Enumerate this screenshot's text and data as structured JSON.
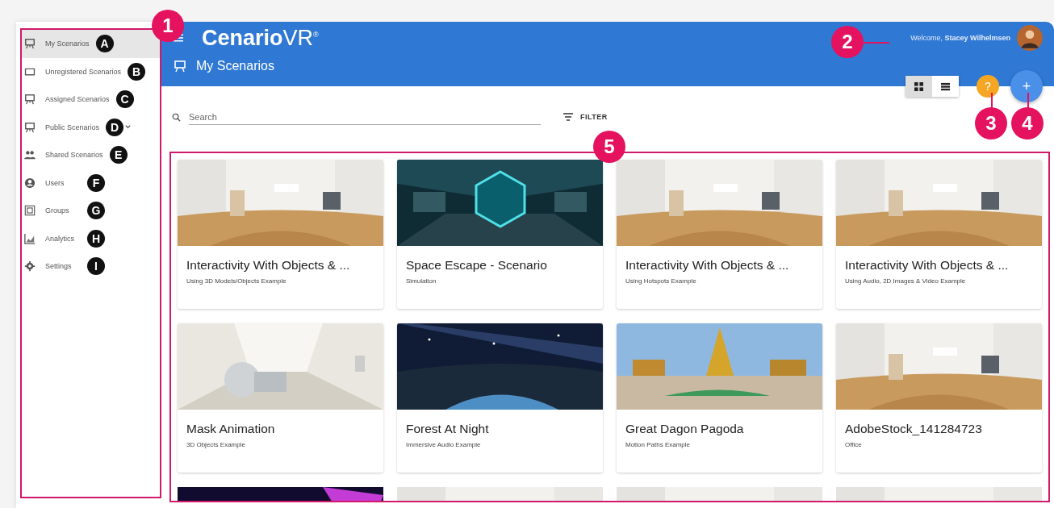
{
  "sidebar": {
    "items": [
      {
        "label": "My Scenarios",
        "selected": true,
        "expandable": false,
        "badge": "A"
      },
      {
        "label": "Unregistered Scenarios",
        "selected": false,
        "expandable": false,
        "badge": "B"
      },
      {
        "label": "Assigned Scenarios",
        "selected": false,
        "expandable": false,
        "badge": "C"
      },
      {
        "label": "Public Scenarios",
        "selected": false,
        "expandable": true,
        "badge": "D"
      },
      {
        "label": "Shared Scenarios",
        "selected": false,
        "expandable": false,
        "badge": "E"
      },
      {
        "label": "Users",
        "selected": false,
        "expandable": false,
        "badge": "F"
      },
      {
        "label": "Groups",
        "selected": false,
        "expandable": false,
        "badge": "G"
      },
      {
        "label": "Analytics",
        "selected": false,
        "expandable": false,
        "badge": "H"
      },
      {
        "label": "Settings",
        "selected": false,
        "expandable": false,
        "badge": "I"
      }
    ]
  },
  "header": {
    "logo": {
      "name": "Cenario",
      "suffix": "VR",
      "mark": "®"
    },
    "title": "My Scenarios",
    "welcome": "Welcome, **Stacey Wilhelmsen**"
  },
  "view_toggle": [
    {
      "selected": true
    },
    {
      "selected": false
    }
  ],
  "help_button": {
    "label": "?"
  },
  "add_button": {
    "label": "+"
  },
  "search": {
    "placeholder": "Search"
  },
  "filter_button": {
    "label": "FILTER"
  },
  "cards": [
    {
      "title": "Interactivity With Objects & ...",
      "subtitle": "Using 3D Models/Objects Example"
    },
    {
      "title": "Space Escape - Scenario",
      "subtitle": "Simulation"
    },
    {
      "title": "Interactivity With Objects & ...",
      "subtitle": "Using Hotspots Example"
    },
    {
      "title": "Interactivity With Objects & ...",
      "subtitle": "Using Audio, 2D Images & Video Example"
    },
    {
      "title": "Mask Animation",
      "subtitle": "3D Objects Example"
    },
    {
      "title": "Forest At Night",
      "subtitle": "Immersive Audio Example"
    },
    {
      "title": "Great Dagon Pagoda",
      "subtitle": "Motion Paths Example"
    },
    {
      "title": "AdobeStock_141284723",
      "subtitle": "Office"
    },
    {
      "kind": "picture"
    },
    {
      "kind": "picture"
    },
    {
      "kind": "picture"
    },
    {
      "kind": "picture"
    }
  ],
  "callouts": [
    {
      "label": "1"
    },
    {
      "label": "2"
    },
    {
      "label": "3"
    },
    {
      "label": "4"
    },
    {
      "label": "5"
    }
  ]
}
